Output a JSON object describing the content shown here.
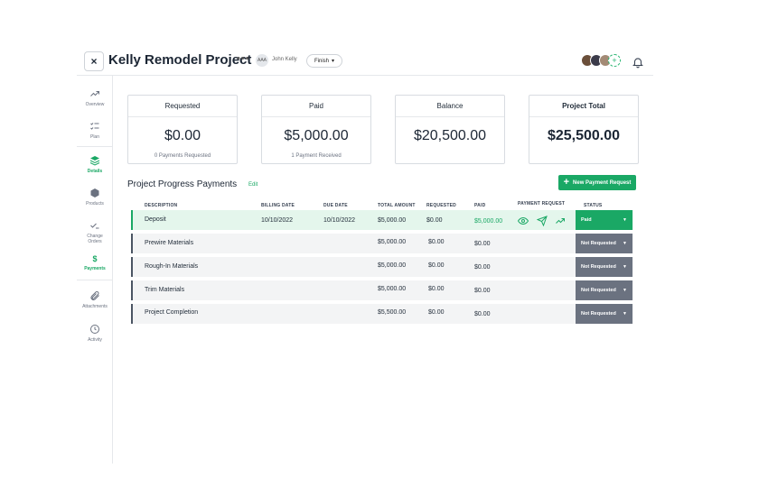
{
  "header": {
    "close_label": "×",
    "title": "Kelly Remodel Project",
    "more_label": "•••",
    "assignee_initials": "AAA",
    "assignee_name": "John Kelly",
    "stage": "Finish",
    "add_member_label": "+"
  },
  "sidebar": {
    "items": [
      {
        "label": "Overview",
        "icon": "trend-up-icon"
      },
      {
        "label": "Plan",
        "icon": "checklist-icon"
      },
      {
        "label": "Details",
        "icon": "layers-icon",
        "active": true
      },
      {
        "label": "Products",
        "icon": "box-icon"
      },
      {
        "label": "Change Orders",
        "icon": "check-line-icon"
      },
      {
        "label": "Payments",
        "icon": "dollar-icon",
        "active": true
      },
      {
        "label": "Attachments",
        "icon": "paperclip-icon"
      },
      {
        "label": "Activity",
        "icon": "history-icon"
      }
    ]
  },
  "summary": [
    {
      "label": "Requested",
      "amount": "$0.00",
      "sub": "0 Payments Requested"
    },
    {
      "label": "Paid",
      "amount": "$5,000.00",
      "sub": "1 Payment Received"
    },
    {
      "label": "Balance",
      "amount": "$20,500.00",
      "sub": ""
    },
    {
      "label": "Project Total",
      "amount": "$25,500.00",
      "sub": ""
    }
  ],
  "section": {
    "title": "Project Progress Payments",
    "edit_label": "Edit",
    "new_button": "New Payment Request"
  },
  "table": {
    "headers": {
      "description": "Description",
      "billing_date": "Billing Date",
      "due_date": "Due Date",
      "total_amount": "Total Amount",
      "requested": "Requested",
      "paid": "Paid",
      "payment_request": "Payment Request",
      "status": "Status"
    },
    "rows": [
      {
        "description": "Deposit",
        "billing_date": "10/10/2022",
        "due_date": "10/10/2022",
        "total": "$5,000.00",
        "requested": "$0.00",
        "paid": "$5,000.00",
        "status": "Paid"
      },
      {
        "description": "Prewire Materials",
        "billing_date": "",
        "due_date": "",
        "total": "$5,000.00",
        "requested": "$0.00",
        "paid": "$0.00",
        "status": "Not Requested"
      },
      {
        "description": "Rough-In Materials",
        "billing_date": "",
        "due_date": "",
        "total": "$5,000.00",
        "requested": "$0.00",
        "paid": "$0.00",
        "status": "Not Requested"
      },
      {
        "description": "Trim Materials",
        "billing_date": "",
        "due_date": "",
        "total": "$5,000.00",
        "requested": "$0.00",
        "paid": "$0.00",
        "status": "Not Requested"
      },
      {
        "description": "Project Completion",
        "billing_date": "",
        "due_date": "",
        "total": "$5,500.00",
        "requested": "$0.00",
        "paid": "$0.00",
        "status": "Not Requested"
      }
    ]
  },
  "colors": {
    "accent": "#1aa865",
    "status_pending": "#6b7280"
  }
}
